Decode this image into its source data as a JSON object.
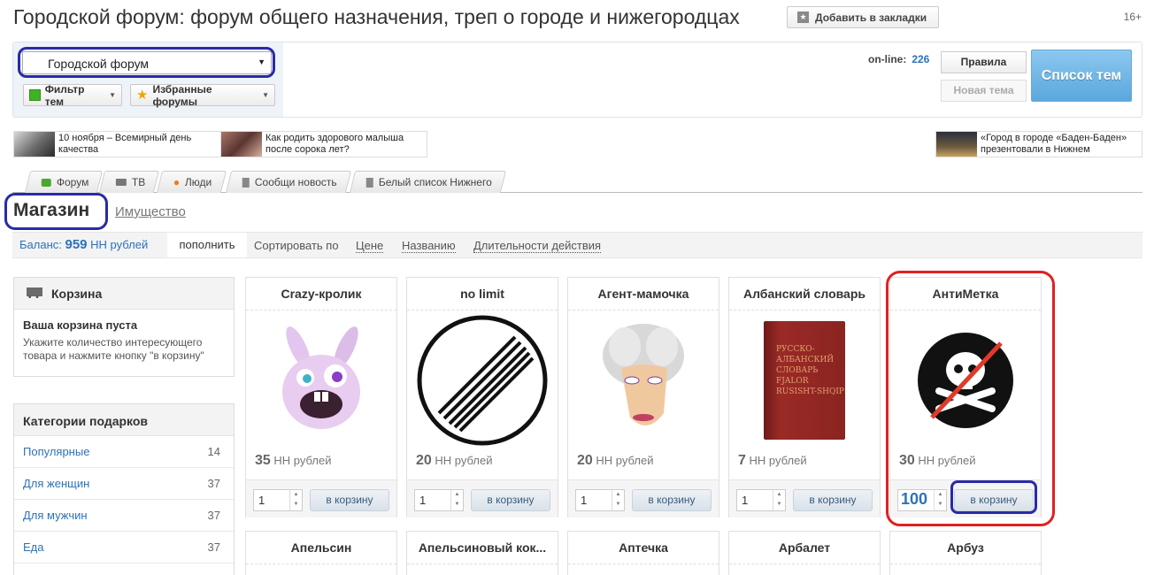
{
  "header": {
    "title": "Городской форум: форум общего назначения, треп о городе и нижегородцах",
    "bookmark_label": "Добавить в закладки",
    "age_rating": "16+"
  },
  "toolbar": {
    "forum_select": "Городской форум",
    "filter_label": "Фильтр тем",
    "favorites_label": "Избранные форумы",
    "online_label": "on-line:",
    "online_count": "226",
    "rules_label": "Правила",
    "new_topic_label": "Новая тема",
    "topic_list_label": "Список тем"
  },
  "news": [
    {
      "text": "10 ноября – Всемирный день качества"
    },
    {
      "text": "Как родить здорового малыша после сорока лет?"
    },
    {
      "text": "«Город в городе «Баден-Баден» презентовали в Нижнем Новгороде"
    }
  ],
  "tabs": [
    {
      "label": "Форум",
      "icon": "chat-bubble-icon"
    },
    {
      "label": "ТВ",
      "icon": "camera-icon"
    },
    {
      "label": "Люди",
      "icon": "person-icon"
    },
    {
      "label": "Сообщи новость",
      "icon": "document-icon"
    },
    {
      "label": "Белый список Нижнего",
      "icon": "document-icon"
    }
  ],
  "shop": {
    "title": "Магазин",
    "property_link": "Имущество",
    "balance_label": "Баланс:",
    "balance_value": "959",
    "balance_unit": "НН рублей",
    "topup_label": "пополнить",
    "sort_label": "Сортировать по",
    "sort_options": [
      "Цене",
      "Названию",
      "Длительности действия"
    ]
  },
  "cart": {
    "title": "Корзина",
    "empty_text": "Ваша корзина пуста",
    "hint": "Укажите количество интересующего товара и нажмите кнопку \"в корзину\""
  },
  "categories": {
    "title": "Категории подарков",
    "items": [
      {
        "name": "Популярные",
        "count": "14"
      },
      {
        "name": "Для женщин",
        "count": "37"
      },
      {
        "name": "Для мужчин",
        "count": "37"
      },
      {
        "name": "Еда",
        "count": "37"
      }
    ]
  },
  "products": [
    {
      "title": "Crazy-кролик",
      "price": "35",
      "currency": "НН рублей",
      "qty": "1",
      "button": "в корзину"
    },
    {
      "title": "no limit",
      "price": "20",
      "currency": "НН рублей",
      "qty": "1",
      "button": "в корзину"
    },
    {
      "title": "Агент-мамочка",
      "price": "20",
      "currency": "НН рублей",
      "qty": "1",
      "button": "в корзину"
    },
    {
      "title": "Албанский словарь",
      "price": "7",
      "currency": "НН рублей",
      "qty": "1",
      "button": "в корзину",
      "book_text": "РУССКО-АЛБАНСКИЙ СЛОВАРЬ FJALOR RUSISHT-SHQIP"
    },
    {
      "title": "АнтиМетка",
      "price": "30",
      "currency": "НН рублей",
      "qty": "100",
      "button": "в корзину"
    }
  ],
  "products_row2": [
    {
      "title": "Апельсин"
    },
    {
      "title": "Апельсиновый кок..."
    },
    {
      "title": "Аптечка"
    },
    {
      "title": "Арбалет"
    },
    {
      "title": "Арбуз"
    }
  ],
  "colors": {
    "accent_blue": "#2d72b8",
    "annotation_blue": "#2a2aa8",
    "annotation_red": "#e02020",
    "topic_button": "#5aa7dd"
  }
}
